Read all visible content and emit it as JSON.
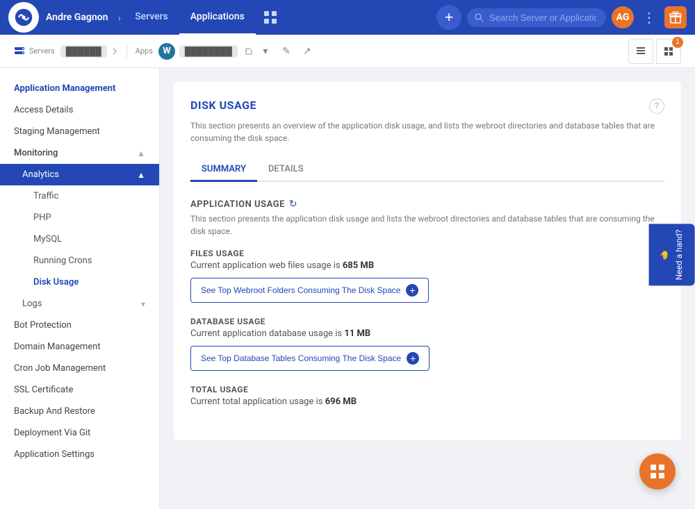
{
  "topnav": {
    "user": "Andre Gagnon",
    "links": [
      {
        "label": "Servers",
        "active": false
      },
      {
        "label": "Applications",
        "active": true
      }
    ],
    "add_label": "+",
    "search_placeholder": "Search Server or Application",
    "avatar_initials": "AG"
  },
  "breadcrumb": {
    "servers_label": "Servers",
    "apps_label": "Apps",
    "server_name": "██████",
    "app_name": "████████",
    "file_count": "1"
  },
  "sidebar": {
    "section_title": "Application Management",
    "items": [
      {
        "label": "Access Details",
        "active": false,
        "sub": false
      },
      {
        "label": "Staging Management",
        "active": false,
        "sub": false
      },
      {
        "label": "Monitoring",
        "active": false,
        "sub": false,
        "has_children": true,
        "expanded": true
      },
      {
        "label": "Analytics",
        "active": true,
        "sub": true,
        "expanded": true
      },
      {
        "label": "Traffic",
        "active": false,
        "sub": true,
        "level2": true
      },
      {
        "label": "PHP",
        "active": false,
        "sub": true,
        "level2": true
      },
      {
        "label": "MySQL",
        "active": false,
        "sub": true,
        "level2": true
      },
      {
        "label": "Running Crons",
        "active": false,
        "sub": true,
        "level2": true
      },
      {
        "label": "Disk Usage",
        "active": false,
        "sub": true,
        "level2": true,
        "active_sub": true
      },
      {
        "label": "Logs",
        "active": false,
        "sub": true,
        "has_children": true
      },
      {
        "label": "Bot Protection",
        "active": false,
        "sub": false
      },
      {
        "label": "Domain Management",
        "active": false,
        "sub": false
      },
      {
        "label": "Cron Job Management",
        "active": false,
        "sub": false
      },
      {
        "label": "SSL Certificate",
        "active": false,
        "sub": false
      },
      {
        "label": "Backup And Restore",
        "active": false,
        "sub": false
      },
      {
        "label": "Deployment Via Git",
        "active": false,
        "sub": false
      },
      {
        "label": "Application Settings",
        "active": false,
        "sub": false
      }
    ]
  },
  "content": {
    "page_title": "DISK USAGE",
    "page_description": "This section presents an overview of the application disk usage, and lists the webroot directories and database tables that are consuming the disk space.",
    "tabs": [
      {
        "label": "SUMMARY",
        "active": true
      },
      {
        "label": "DETAILS",
        "active": false
      }
    ],
    "app_usage_title": "APPLICATION USAGE",
    "app_usage_desc": "This section presents the application disk usage and lists the webroot directories and database tables that are consuming the disk space.",
    "files_usage_title": "FILES USAGE",
    "files_usage_desc_prefix": "Current application web files usage is",
    "files_usage_value": "685 MB",
    "files_btn": "See Top Webroot Folders Consuming The Disk Space",
    "db_usage_title": "DATABASE USAGE",
    "db_usage_desc_prefix": "Current application database usage is",
    "db_usage_value": "11 MB",
    "db_btn": "See Top Database Tables Consuming The Disk Space",
    "total_usage_title": "TOTAL USAGE",
    "total_usage_desc_prefix": "Current total application usage is",
    "total_usage_value": "696 MB"
  },
  "need_a_hand": "Need a hand?",
  "fab_icon": "⊞"
}
